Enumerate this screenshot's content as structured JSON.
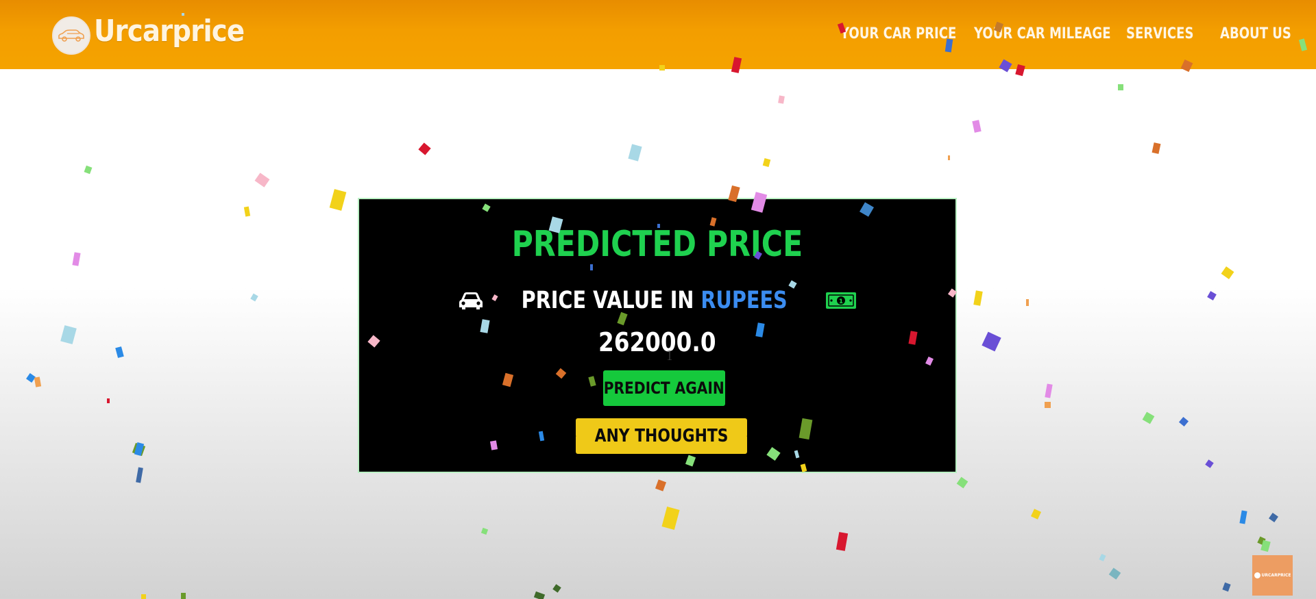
{
  "brand": {
    "name": "Urcarprice",
    "logo_icon": "car-icon"
  },
  "nav": {
    "items": [
      {
        "label": "YOUR CAR PRICE"
      },
      {
        "label": "YOUR CAR MILEAGE"
      },
      {
        "label": "SERVICES"
      },
      {
        "label": "ABOUT US"
      }
    ]
  },
  "result": {
    "title": "PREDICTED PRICE",
    "label": "PRICE VALUE IN",
    "currency": "RUPEES",
    "value": "262000.0",
    "leading_icon": "car-icon",
    "trailing_icon": "money-bill-icon"
  },
  "buttons": {
    "predict_again": "PREDICT AGAIN",
    "thoughts": "ANY THOUGHTS",
    "thoughts_icon": "star-icon"
  },
  "corner_badge": {
    "text": "URCARPRICE"
  },
  "colors": {
    "navbar": "#f5a300",
    "title_green": "#1fd14f",
    "currency_blue": "#3b8cf0",
    "predict_button": "#15c93c",
    "thoughts_button": "#efc918",
    "card": "#000000"
  }
}
